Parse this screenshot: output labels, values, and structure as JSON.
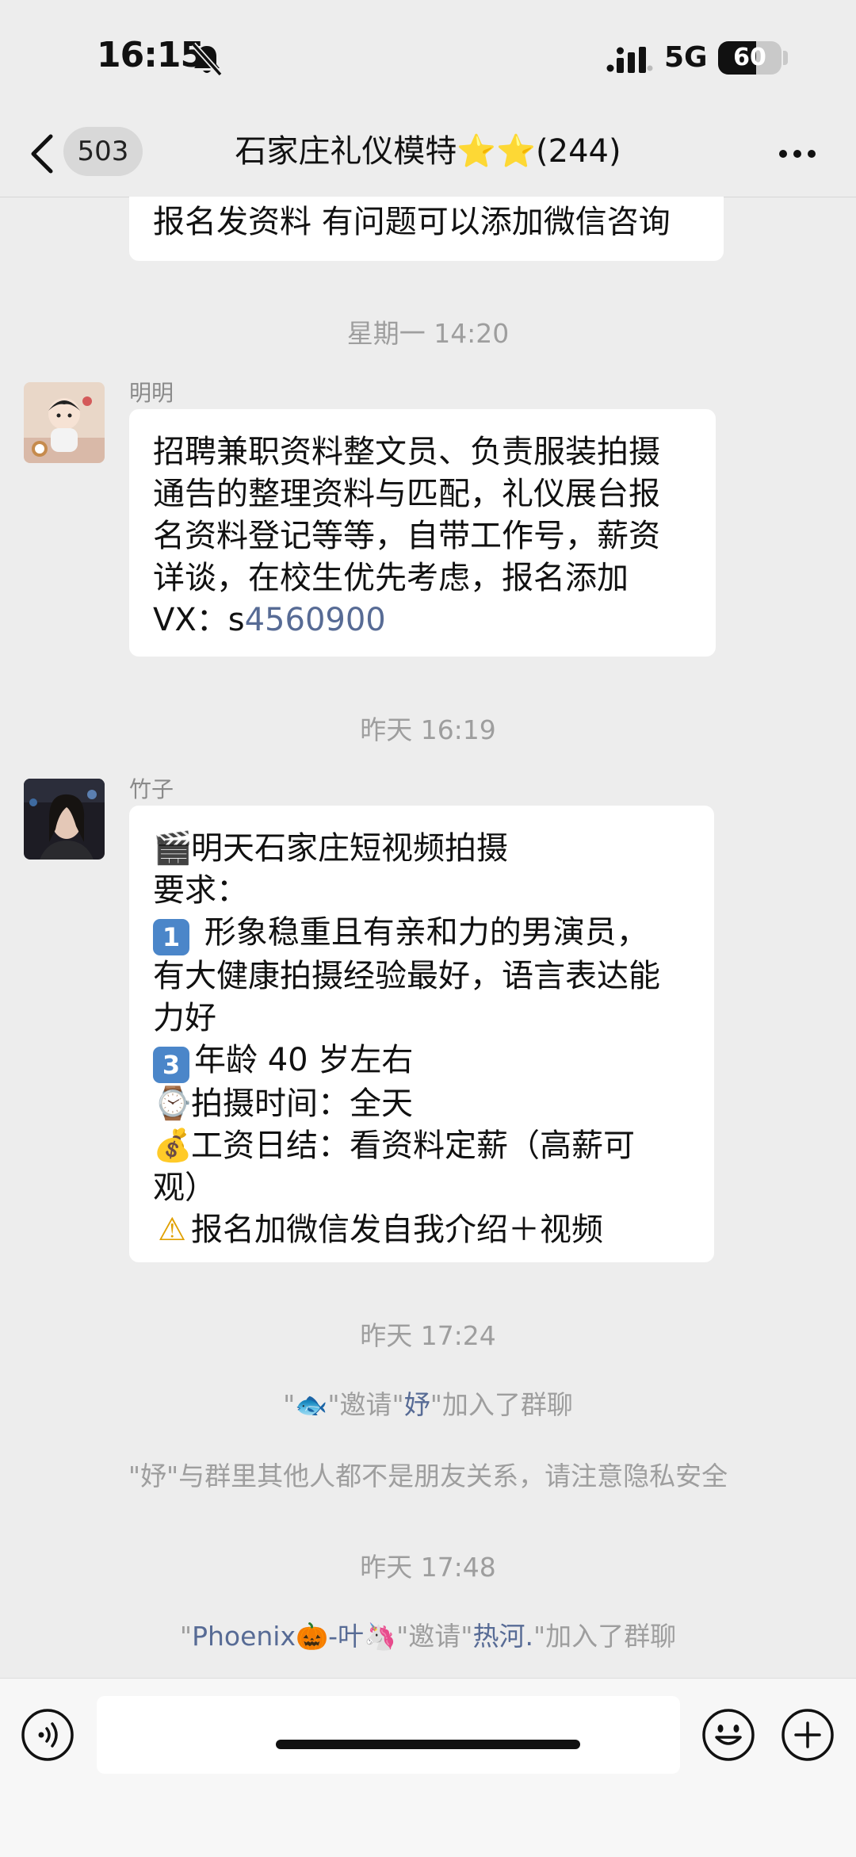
{
  "status_bar": {
    "time": "16:15",
    "network": "5G",
    "battery": "60",
    "battery_level": 0.6
  },
  "nav": {
    "unread_badge": "503",
    "title": "石家庄礼仪模特⭐️⭐️(244)"
  },
  "messages": {
    "m0": {
      "lines": [
        "报名发资料 有问题可以添加微信咨询"
      ]
    },
    "ts1": "星期一 14:20",
    "m1": {
      "sender": "明明",
      "lines": [
        "招聘兼职资料整文员、负责服装拍摄",
        "通告的整理资料与匹配，礼仪展台报",
        "名资料登记等等，自带工作号，薪资",
        "详谈，在校生优先考虑，报名添加"
      ],
      "vx_prefix": "VX：s",
      "vx_number": "4560900"
    },
    "ts2": "昨天 16:19",
    "m2": {
      "sender": "竹子",
      "line1_emoji": "🎬",
      "line1": "明天石家庄短视频拍摄",
      "line2": "要求：",
      "line3_key": "1",
      "line3": " 形象稳重且有亲和力的男演员，",
      "line4": "有大健康拍摄经验最好，语言表达能",
      "line5": "力好",
      "line6_key": "3",
      "line6": "年龄 40 岁左右",
      "line7_emoji": "⌚",
      "line7": "拍摄时间：全天",
      "line8_emoji": "💰",
      "line8": "工资日结：看资料定薪（高薪可",
      "line9": "观）",
      "line10_emoji": "⚠",
      "line10": "报名加微信发自我介绍＋视频"
    },
    "ts3": "昨天 17:24",
    "sys1": {
      "q1": "\"",
      "inviter": "🐟",
      "mid": "\"邀请\"",
      "invitee": "妤",
      "end": "\"加入了群聊"
    },
    "sys2": "\"妤\"与群里其他人都不是朋友关系，请注意隐私安全",
    "ts4": "昨天 17:48",
    "sys3": {
      "q1": "\"",
      "inviter": "Phoenix🎃-叶🦄",
      "mid": "\"邀请\"",
      "invitee": "热河.",
      "end": "\"加入了群聊"
    }
  },
  "icons": [
    "back-icon",
    "more-icon",
    "voice-icon",
    "emoji-icon",
    "plus-icon",
    "bell-muted-icon",
    "signal-icon",
    "battery-icon"
  ],
  "colors": {
    "background": "#ededed",
    "bubble": "#ffffff",
    "link": "#576b95",
    "timestamp": "#9e9e9e"
  }
}
